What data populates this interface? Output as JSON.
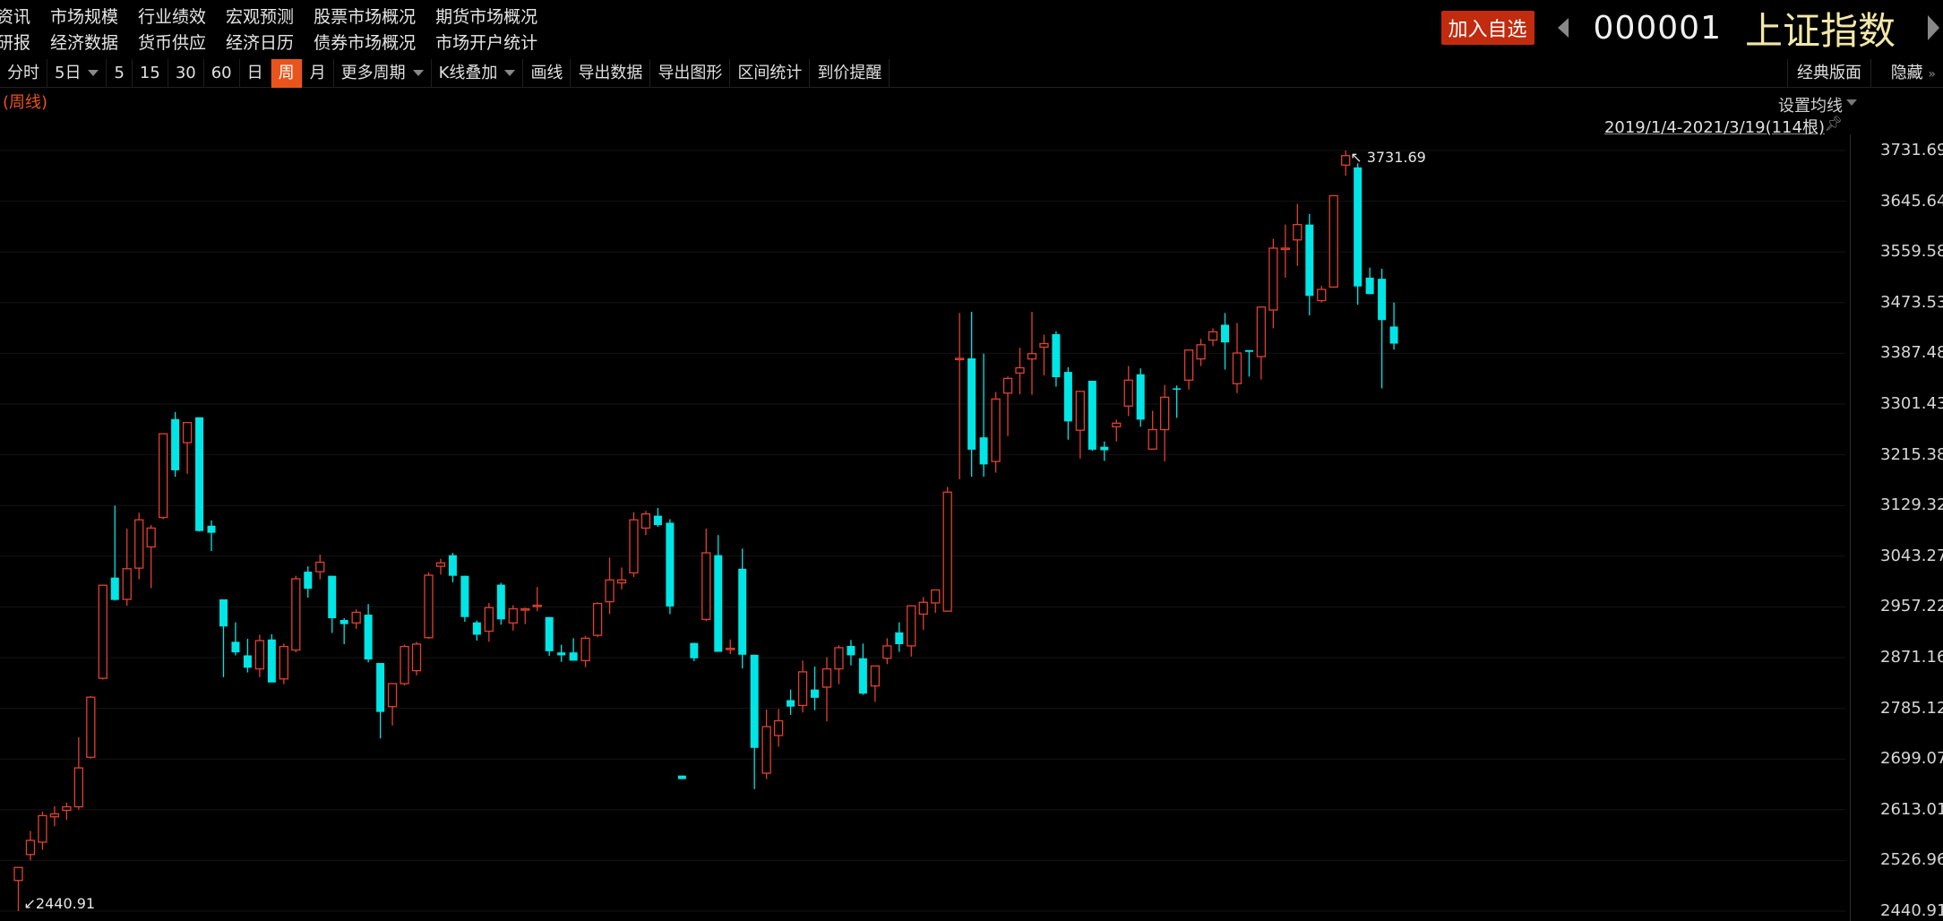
{
  "menu": {
    "row1": [
      "资讯",
      "市场规模",
      "行业绩效",
      "宏观预测",
      "股票市场概况",
      "期货市场概况"
    ],
    "row2": [
      "研报",
      "经济数据",
      "货币供应",
      "经济日历",
      "债券市场概况",
      "市场开户统计"
    ]
  },
  "header": {
    "add_watch": "加入自选",
    "code": "000001",
    "name": "上证指数"
  },
  "toolbar": {
    "items": [
      {
        "label": "分时",
        "dropdown": false
      },
      {
        "label": "5日",
        "dropdown": true
      },
      {
        "label": "5",
        "dropdown": false
      },
      {
        "label": "15",
        "dropdown": false
      },
      {
        "label": "30",
        "dropdown": false
      },
      {
        "label": "60",
        "dropdown": false
      },
      {
        "label": "日",
        "dropdown": false
      },
      {
        "label": "周",
        "dropdown": false,
        "active": true
      },
      {
        "label": "月",
        "dropdown": false
      },
      {
        "label": "更多周期",
        "dropdown": true
      },
      {
        "label": "K线叠加",
        "dropdown": true
      },
      {
        "label": "画线",
        "dropdown": false
      },
      {
        "label": "导出数据",
        "dropdown": false
      },
      {
        "label": "导出图形",
        "dropdown": false
      },
      {
        "label": "区间统计",
        "dropdown": false
      },
      {
        "label": "到价提醒",
        "dropdown": false
      }
    ],
    "classic": "经典版面",
    "hide": "隐藏"
  },
  "chart_meta": {
    "period_note": "(周线)",
    "ma_setting": "设置均线",
    "range": "2019/1/4-2021/3/19(114根)"
  },
  "colors": {
    "up": "#e0412f",
    "down": "#00e5e5",
    "accent": "#e8541c",
    "name": "#f3e7a7"
  },
  "chart_data": {
    "type": "candlestick",
    "ylim": [
      2440.91,
      3731.69
    ],
    "yticks": [
      "3731.69",
      "3645.64",
      "3559.58",
      "3473.53",
      "3387.48",
      "3301.43",
      "3215.38",
      "3129.32",
      "3043.27",
      "2957.22",
      "2871.16",
      "2785.12",
      "2699.07",
      "2613.01",
      "2526.96",
      "2440.91"
    ],
    "high_label": "3731.69",
    "low_label": "2440.91",
    "candles": [
      {
        "o": 2493,
        "h": 2515,
        "l": 2440.91,
        "c": 2515
      },
      {
        "o": 2537,
        "h": 2577,
        "l": 2527,
        "c": 2561
      },
      {
        "o": 2558,
        "h": 2610,
        "l": 2545,
        "c": 2603
      },
      {
        "o": 2601,
        "h": 2619,
        "l": 2585,
        "c": 2606
      },
      {
        "o": 2612,
        "h": 2625,
        "l": 2596,
        "c": 2618
      },
      {
        "o": 2618,
        "h": 2736,
        "l": 2613,
        "c": 2684
      },
      {
        "o": 2702,
        "h": 2806,
        "l": 2700,
        "c": 2804
      },
      {
        "o": 2836,
        "h": 2995,
        "l": 2834,
        "c": 2994
      },
      {
        "o": 3007,
        "h": 3129,
        "l": 2968,
        "c": 2969
      },
      {
        "o": 2970,
        "h": 3090,
        "l": 2959,
        "c": 3022
      },
      {
        "o": 3023,
        "h": 3117,
        "l": 3004,
        "c": 3105
      },
      {
        "o": 3059,
        "h": 3096,
        "l": 2989,
        "c": 3091
      },
      {
        "o": 3109,
        "h": 3252,
        "l": 3106,
        "c": 3251
      },
      {
        "o": 3276,
        "h": 3288,
        "l": 3178,
        "c": 3189
      },
      {
        "o": 3236,
        "h": 3270,
        "l": 3183,
        "c": 3270
      },
      {
        "o": 3279,
        "h": 3279,
        "l": 3085,
        "c": 3086
      },
      {
        "o": 3095,
        "h": 3104,
        "l": 3052,
        "c": 3083
      },
      {
        "o": 2970,
        "h": 2970,
        "l": 2838,
        "c": 2924
      },
      {
        "o": 2898,
        "h": 2931,
        "l": 2875,
        "c": 2880
      },
      {
        "o": 2875,
        "h": 2903,
        "l": 2846,
        "c": 2854
      },
      {
        "o": 2852,
        "h": 2910,
        "l": 2838,
        "c": 2900
      },
      {
        "o": 2902,
        "h": 2911,
        "l": 2830,
        "c": 2829
      },
      {
        "o": 2835,
        "h": 2895,
        "l": 2826,
        "c": 2890
      },
      {
        "o": 2884,
        "h": 3010,
        "l": 2880,
        "c": 3005
      },
      {
        "o": 3017,
        "h": 3026,
        "l": 2973,
        "c": 2988
      },
      {
        "o": 3017,
        "h": 3046,
        "l": 3004,
        "c": 3033
      },
      {
        "o": 3010,
        "h": 3010,
        "l": 2913,
        "c": 2938
      },
      {
        "o": 2935,
        "h": 2938,
        "l": 2894,
        "c": 2928
      },
      {
        "o": 2930,
        "h": 2953,
        "l": 2920,
        "c": 2948
      },
      {
        "o": 2944,
        "h": 2962,
        "l": 2863,
        "c": 2868
      },
      {
        "o": 2862,
        "h": 2862,
        "l": 2734,
        "c": 2779
      },
      {
        "o": 2788,
        "h": 2825,
        "l": 2756,
        "c": 2827
      },
      {
        "o": 2827,
        "h": 2893,
        "l": 2824,
        "c": 2890
      },
      {
        "o": 2849,
        "h": 2898,
        "l": 2841,
        "c": 2894
      },
      {
        "o": 2905,
        "h": 3016,
        "l": 2903,
        "c": 3011
      },
      {
        "o": 3026,
        "h": 3039,
        "l": 3012,
        "c": 3032
      },
      {
        "o": 3045,
        "h": 3049,
        "l": 2999,
        "c": 3010
      },
      {
        "o": 3010,
        "h": 3010,
        "l": 2932,
        "c": 2940
      },
      {
        "o": 2931,
        "h": 2934,
        "l": 2900,
        "c": 2910
      },
      {
        "o": 2916,
        "h": 2964,
        "l": 2898,
        "c": 2956
      },
      {
        "o": 2995,
        "h": 2998,
        "l": 2927,
        "c": 2936
      },
      {
        "o": 2930,
        "h": 2960,
        "l": 2917,
        "c": 2954
      },
      {
        "o": 2952,
        "h": 2956,
        "l": 2928,
        "c": 2954
      },
      {
        "o": 2959,
        "h": 2991,
        "l": 2950,
        "c": 2960
      },
      {
        "o": 2940,
        "h": 2940,
        "l": 2874,
        "c": 2882
      },
      {
        "o": 2880,
        "h": 2893,
        "l": 2864,
        "c": 2875
      },
      {
        "o": 2880,
        "h": 2904,
        "l": 2866,
        "c": 2866
      },
      {
        "o": 2866,
        "h": 2908,
        "l": 2855,
        "c": 2904
      },
      {
        "o": 2909,
        "h": 2965,
        "l": 2906,
        "c": 2963
      },
      {
        "o": 2966,
        "h": 3041,
        "l": 2945,
        "c": 3003
      },
      {
        "o": 2998,
        "h": 3024,
        "l": 2987,
        "c": 3003
      },
      {
        "o": 3015,
        "h": 3118,
        "l": 3008,
        "c": 3105
      },
      {
        "o": 3091,
        "h": 3120,
        "l": 3079,
        "c": 3115
      },
      {
        "o": 3112,
        "h": 3125,
        "l": 3093,
        "c": 3096
      },
      {
        "o": 3100,
        "h": 3106,
        "l": 2945,
        "c": 2958
      },
      {
        "o": 2671,
        "h": 2671,
        "l": 2665,
        "c": 2665
      },
      {
        "o": 2896,
        "h": 2896,
        "l": 2865,
        "c": 2870
      },
      {
        "o": 2936,
        "h": 3090,
        "l": 2933,
        "c": 3049
      },
      {
        "o": 3045,
        "h": 3079,
        "l": 2881,
        "c": 2881
      },
      {
        "o": 2885,
        "h": 2902,
        "l": 2877,
        "c": 2887
      },
      {
        "o": 3022,
        "h": 3056,
        "l": 2853,
        "c": 2876
      },
      {
        "o": 2876,
        "h": 2876,
        "l": 2648,
        "c": 2718
      },
      {
        "o": 2675,
        "h": 2783,
        "l": 2665,
        "c": 2754
      },
      {
        "o": 2739,
        "h": 2784,
        "l": 2720,
        "c": 2764
      },
      {
        "o": 2799,
        "h": 2817,
        "l": 2774,
        "c": 2788
      },
      {
        "o": 2790,
        "h": 2866,
        "l": 2778,
        "c": 2847
      },
      {
        "o": 2817,
        "h": 2856,
        "l": 2782,
        "c": 2803
      },
      {
        "o": 2821,
        "h": 2872,
        "l": 2763,
        "c": 2852
      },
      {
        "o": 2852,
        "h": 2892,
        "l": 2826,
        "c": 2888
      },
      {
        "o": 2891,
        "h": 2901,
        "l": 2858,
        "c": 2875
      },
      {
        "o": 2870,
        "h": 2895,
        "l": 2808,
        "c": 2810
      },
      {
        "o": 2823,
        "h": 2839,
        "l": 2796,
        "c": 2857
      },
      {
        "o": 2870,
        "h": 2904,
        "l": 2860,
        "c": 2891
      },
      {
        "o": 2914,
        "h": 2931,
        "l": 2881,
        "c": 2894
      },
      {
        "o": 2891,
        "h": 2919,
        "l": 2873,
        "c": 2959
      },
      {
        "o": 2945,
        "h": 2974,
        "l": 2918,
        "c": 2965
      },
      {
        "o": 2964,
        "h": 2979,
        "l": 2947,
        "c": 2986
      },
      {
        "o": 2950,
        "h": 3161,
        "l": 2950,
        "c": 3152
      },
      {
        "o": 3379,
        "h": 3456,
        "l": 3174,
        "c": 3379
      },
      {
        "o": 3379,
        "h": 3458,
        "l": 3178,
        "c": 3224
      },
      {
        "o": 3245,
        "h": 3387,
        "l": 3178,
        "c": 3199
      },
      {
        "o": 3204,
        "h": 3322,
        "l": 3185,
        "c": 3310
      },
      {
        "o": 3320,
        "h": 3348,
        "l": 3247,
        "c": 3345
      },
      {
        "o": 3354,
        "h": 3397,
        "l": 3318,
        "c": 3363
      },
      {
        "o": 3378,
        "h": 3458,
        "l": 3317,
        "c": 3387
      },
      {
        "o": 3398,
        "h": 3419,
        "l": 3350,
        "c": 3404
      },
      {
        "o": 3420,
        "h": 3425,
        "l": 3331,
        "c": 3347
      },
      {
        "o": 3356,
        "h": 3364,
        "l": 3241,
        "c": 3272
      },
      {
        "o": 3257,
        "h": 3323,
        "l": 3209,
        "c": 3323
      },
      {
        "o": 3341,
        "h": 3341,
        "l": 3222,
        "c": 3224
      },
      {
        "o": 3229,
        "h": 3238,
        "l": 3205,
        "c": 3223
      },
      {
        "o": 3263,
        "h": 3275,
        "l": 3238,
        "c": 3269
      },
      {
        "o": 3298,
        "h": 3366,
        "l": 3281,
        "c": 3342
      },
      {
        "o": 3352,
        "h": 3362,
        "l": 3263,
        "c": 3275
      },
      {
        "o": 3225,
        "h": 3290,
        "l": 3224,
        "c": 3258
      },
      {
        "o": 3258,
        "h": 3334,
        "l": 3204,
        "c": 3313
      },
      {
        "o": 3328,
        "h": 3333,
        "l": 3278,
        "c": 3326
      },
      {
        "o": 3342,
        "h": 3363,
        "l": 3326,
        "c": 3393
      },
      {
        "o": 3378,
        "h": 3412,
        "l": 3366,
        "c": 3402
      },
      {
        "o": 3410,
        "h": 3430,
        "l": 3400,
        "c": 3424
      },
      {
        "o": 3436,
        "h": 3456,
        "l": 3360,
        "c": 3406
      },
      {
        "o": 3336,
        "h": 3439,
        "l": 3320,
        "c": 3388
      },
      {
        "o": 3393,
        "h": 3392,
        "l": 3348,
        "c": 3390
      },
      {
        "o": 3382,
        "h": 3423,
        "l": 3343,
        "c": 3466
      },
      {
        "o": 3461,
        "h": 3582,
        "l": 3430,
        "c": 3566
      },
      {
        "o": 3566,
        "h": 3606,
        "l": 3516,
        "c": 3566
      },
      {
        "o": 3580,
        "h": 3641,
        "l": 3536,
        "c": 3606
      },
      {
        "o": 3606,
        "h": 3624,
        "l": 3452,
        "c": 3485
      },
      {
        "o": 3477,
        "h": 3502,
        "l": 3474,
        "c": 3496
      },
      {
        "o": 3500,
        "h": 3655,
        "l": 3500,
        "c": 3655
      },
      {
        "o": 3707,
        "h": 3731.69,
        "l": 3689,
        "c": 3723
      },
      {
        "o": 3703,
        "h": 3710,
        "l": 3470,
        "c": 3501
      },
      {
        "o": 3516,
        "h": 3533,
        "l": 3488,
        "c": 3488
      },
      {
        "o": 3514,
        "h": 3531,
        "l": 3328,
        "c": 3444
      },
      {
        "o": 3433,
        "h": 3474,
        "l": 3394,
        "c": 3404
      }
    ]
  }
}
